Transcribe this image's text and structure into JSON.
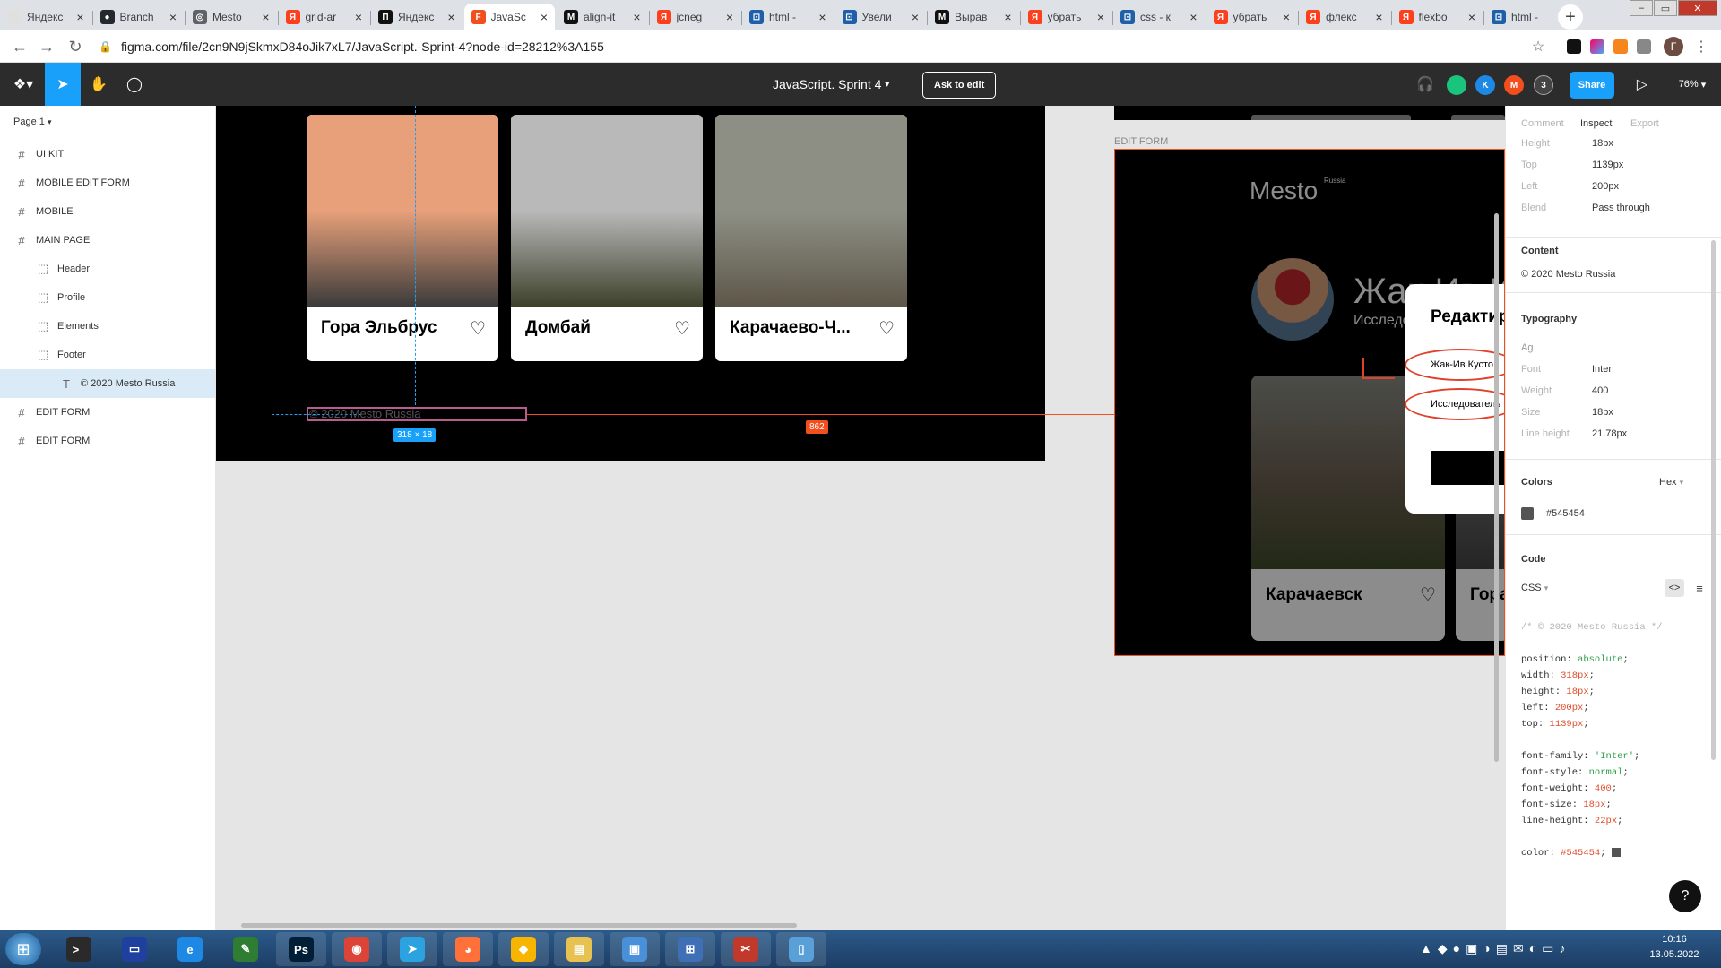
{
  "browser": {
    "tabs": [
      {
        "title": "Яндекс",
        "color": "#e0e0e0",
        "glyph": ""
      },
      {
        "title": "Branch",
        "color": "#24292e",
        "glyph": "●"
      },
      {
        "title": "Mesto",
        "color": "#5f6368",
        "glyph": "◎"
      },
      {
        "title": "grid-ar",
        "color": "#fc3f1d",
        "glyph": "Я"
      },
      {
        "title": "Яндекс",
        "color": "#111111",
        "glyph": "П"
      },
      {
        "title": "JavaSc",
        "color": "#f24e1e",
        "glyph": "F",
        "active": true
      },
      {
        "title": "align-it",
        "color": "#111111",
        "glyph": "M"
      },
      {
        "title": "jcneg",
        "color": "#fc3f1d",
        "glyph": "Я"
      },
      {
        "title": "html -",
        "color": "#1f5fa8",
        "glyph": "⊡"
      },
      {
        "title": "Увели",
        "color": "#1f5fa8",
        "glyph": "⊡"
      },
      {
        "title": "Вырав",
        "color": "#111111",
        "glyph": "M"
      },
      {
        "title": "убрать",
        "color": "#fc3f1d",
        "glyph": "Я"
      },
      {
        "title": "css - к",
        "color": "#1f5fa8",
        "glyph": "⊡"
      },
      {
        "title": "убрать",
        "color": "#fc3f1d",
        "glyph": "Я"
      },
      {
        "title": "флекс",
        "color": "#fc3f1d",
        "glyph": "Я"
      },
      {
        "title": "flexbo",
        "color": "#fc3f1d",
        "glyph": "Я"
      },
      {
        "title": "html -",
        "color": "#1f5fa8",
        "glyph": "⊡"
      }
    ],
    "url": "figma.com/file/2cn9N9jSkmxD84oJik7xL7/JavaScript.-Sprint-4?node-id=28212%3A155",
    "profile_initial": "Г"
  },
  "figma": {
    "file_title": "JavaScript. Sprint 4",
    "ask_to_edit": "Ask to edit",
    "avatars": [
      {
        "letter": "",
        "color": "#1bc47d"
      },
      {
        "letter": "K",
        "color": "#1e88e5"
      },
      {
        "letter": "M",
        "color": "#f24e1e"
      },
      {
        "letter": "3",
        "color": "#444444"
      }
    ],
    "share": "Share",
    "zoom": "76%",
    "page": "Page 1",
    "layers": [
      {
        "label": "UI KIT",
        "icon": "#",
        "indent": 0
      },
      {
        "label": "MOBILE EDIT FORM",
        "icon": "#",
        "indent": 0
      },
      {
        "label": "MOBILE",
        "icon": "#",
        "indent": 0
      },
      {
        "label": "MAIN PAGE",
        "icon": "#",
        "indent": 0
      },
      {
        "label": "Header",
        "icon": "⬚",
        "indent": 1
      },
      {
        "label": "Profile",
        "icon": "⬚",
        "indent": 1
      },
      {
        "label": "Elements",
        "icon": "⬚",
        "indent": 1
      },
      {
        "label": "Footer",
        "icon": "⬚",
        "indent": 1
      },
      {
        "label": "© 2020 Mesto Russia",
        "icon": "T",
        "indent": 2,
        "selected": true
      },
      {
        "label": "EDIT FORM",
        "icon": "#",
        "indent": 0
      },
      {
        "label": "EDIT FORM",
        "icon": "#",
        "indent": 0
      }
    ]
  },
  "canvas": {
    "cards": [
      {
        "title": "Гора Эльбрус",
        "sky": "#e7a07a",
        "ground": "#3a3a3a"
      },
      {
        "title": "Домбай",
        "sky": "#b9b9b9",
        "ground": "#3c3f2a"
      },
      {
        "title": "Карачаево-Ч...",
        "sky": "#8d8f85",
        "ground": "#5d5648"
      }
    ],
    "footer_text": "© 2020 Mesto Russia",
    "size_badge": "318 × 18",
    "distance_badge": "862",
    "edit_form_label": "EDIT FORM",
    "mesto_logo": "Mesto",
    "mesto_sub": "Russia",
    "profile_name_partial": "Жак-Ив К",
    "profile_job_partial": "Исследо",
    "popup_title": "Редактир",
    "popup_field_name": "Жак-Ив Кусто",
    "popup_field_job": "Исследователь",
    "card2_title": "Карачаевск",
    "card3_title_partial": "Гора"
  },
  "inspect": {
    "tabs": [
      "Comment",
      "Inspect",
      "Export"
    ],
    "props": [
      {
        "label": "Height",
        "value": "18px"
      },
      {
        "label": "Top",
        "value": "1139px"
      },
      {
        "label": "Left",
        "value": "200px"
      },
      {
        "label": "Blend",
        "value": "Pass through"
      }
    ],
    "content_head": "Content",
    "content_value": "© 2020 Mesto Russia",
    "typography_head": "Typography",
    "typo_sample": "Ag",
    "typo": [
      {
        "label": "Font",
        "value": "Inter"
      },
      {
        "label": "Weight",
        "value": "400"
      },
      {
        "label": "Size",
        "value": "18px"
      },
      {
        "label": "Line height",
        "value": "21.78px"
      }
    ],
    "colors_head": "Colors",
    "colors_format": "Hex",
    "color_hex": "#545454",
    "code_head": "Code",
    "code_lang": "CSS",
    "code_lines": [
      {
        "t": "c",
        "k": "/* © 2020 Mesto Russia */",
        "v": ""
      },
      {
        "t": "blank",
        "k": "",
        "v": ""
      },
      {
        "t": "g",
        "k": "position: ",
        "v": "absolute"
      },
      {
        "t": "v",
        "k": "width: ",
        "v": "318px"
      },
      {
        "t": "v",
        "k": "height: ",
        "v": "18px"
      },
      {
        "t": "v",
        "k": "left: ",
        "v": "200px"
      },
      {
        "t": "v",
        "k": "top: ",
        "v": "1139px"
      },
      {
        "t": "blank",
        "k": "",
        "v": ""
      },
      {
        "t": "g",
        "k": "font-family: ",
        "v": "'Inter'"
      },
      {
        "t": "g",
        "k": "font-style: ",
        "v": "normal"
      },
      {
        "t": "v",
        "k": "font-weight: ",
        "v": "400"
      },
      {
        "t": "v",
        "k": "font-size: ",
        "v": "18px"
      },
      {
        "t": "v",
        "k": "line-height: ",
        "v": "22px"
      },
      {
        "t": "blank",
        "k": "",
        "v": ""
      },
      {
        "t": "v",
        "k": "color: ",
        "v": "#545454"
      }
    ]
  },
  "taskbar": {
    "time": "10:16",
    "date": "13.05.2022",
    "apps": [
      {
        "name": "cmd",
        "color": "#2a2a2a",
        "glyph": ">_"
      },
      {
        "name": "save",
        "color": "#2040a0",
        "glyph": "▭"
      },
      {
        "name": "ie",
        "color": "#1e88e5",
        "glyph": "e"
      },
      {
        "name": "notepad",
        "color": "#2e7d32",
        "glyph": "✎"
      },
      {
        "name": "photoshop",
        "color": "#001e36",
        "glyph": "Ps"
      },
      {
        "name": "chrome",
        "color": "#db4437",
        "glyph": "◉"
      },
      {
        "name": "telegram",
        "color": "#2aa3e0",
        "glyph": "➤"
      },
      {
        "name": "firefox",
        "color": "#ff7139",
        "glyph": "◕"
      },
      {
        "name": "sketch",
        "color": "#f7b500",
        "glyph": "◆"
      },
      {
        "name": "explorer",
        "color": "#e8c250",
        "glyph": "▤"
      },
      {
        "name": "remote",
        "color": "#4a90d9",
        "glyph": "▣"
      },
      {
        "name": "network",
        "color": "#3f6fb5",
        "glyph": "⊞"
      },
      {
        "name": "tool",
        "color": "#c0392b",
        "glyph": "✂"
      },
      {
        "name": "files",
        "color": "#5aa0d8",
        "glyph": "▯"
      }
    ]
  }
}
